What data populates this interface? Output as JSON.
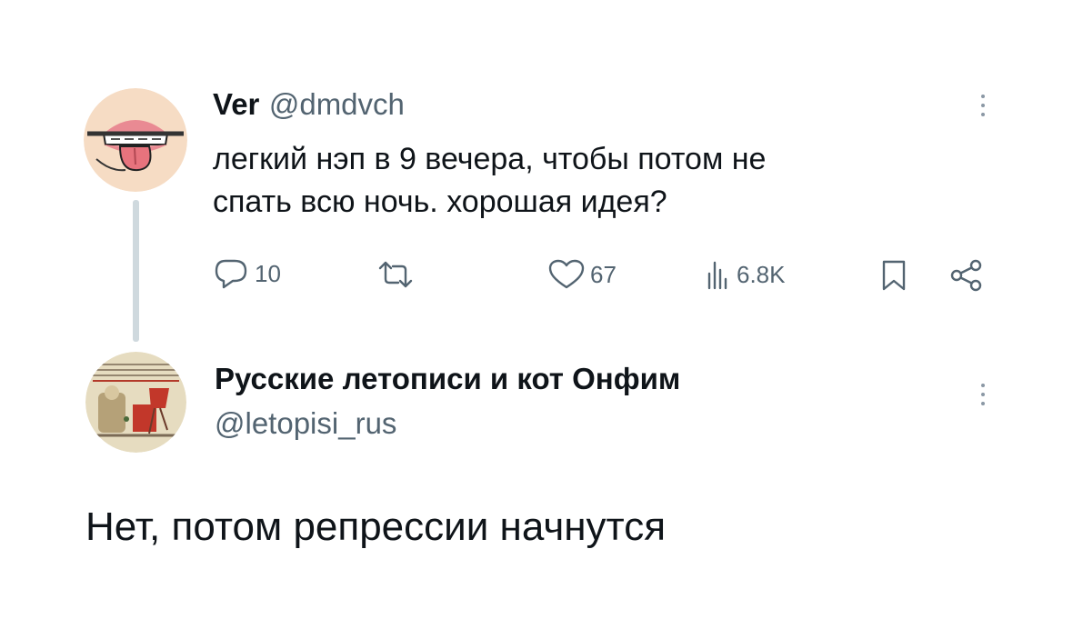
{
  "original_tweet": {
    "author_name": "Ver",
    "author_handle": "@dmdvch",
    "text_line_1": "легкий нэп в 9 вечера, чтобы потом не",
    "text_line_2": "спать всю ночь. хорошая идея?",
    "actions": {
      "replies": "10",
      "retweets": "",
      "likes": "67",
      "views": "6.8K"
    }
  },
  "reply": {
    "author_name": "Русские летописи и кот Онфим",
    "author_handle": "@letopisi_rus",
    "text": "Нет, потом репрессии начнутся"
  },
  "icons": {
    "reply": "speech-bubble-icon",
    "retweet": "retweet-icon",
    "like": "heart-icon",
    "views": "bar-chart-icon",
    "bookmark": "bookmark-icon",
    "share": "share-icon",
    "more": "vertical-dots-icon"
  },
  "colors": {
    "text": "#0f1419",
    "secondary": "#536471",
    "thread_line": "#cfd9de"
  }
}
